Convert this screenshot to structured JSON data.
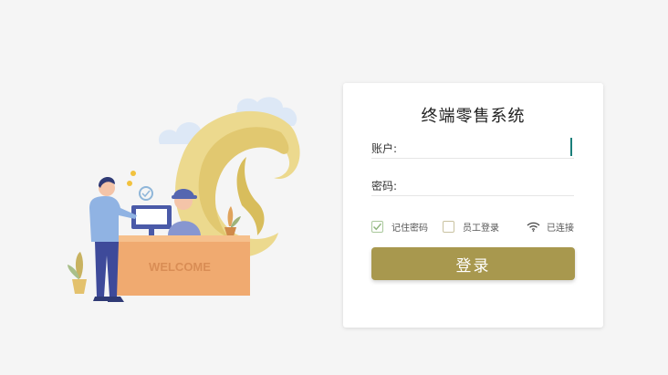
{
  "illustration": {
    "desk_sign": "WELCOME"
  },
  "login": {
    "title": "终端零售系统",
    "account_label": "账户:",
    "account_value": "",
    "password_label": "密码:",
    "password_value": "",
    "remember_label": "记住密码",
    "remember_checked": true,
    "staff_label": "员工登录",
    "staff_checked": false,
    "connection_status": "已连接",
    "submit_label": "登录"
  },
  "colors": {
    "background": "#f5f5f5",
    "button": "#a8984e",
    "cursor": "#1a7f7a",
    "check": "#8fb57d"
  },
  "icons": [
    "checkmark-icon",
    "wifi-icon"
  ]
}
